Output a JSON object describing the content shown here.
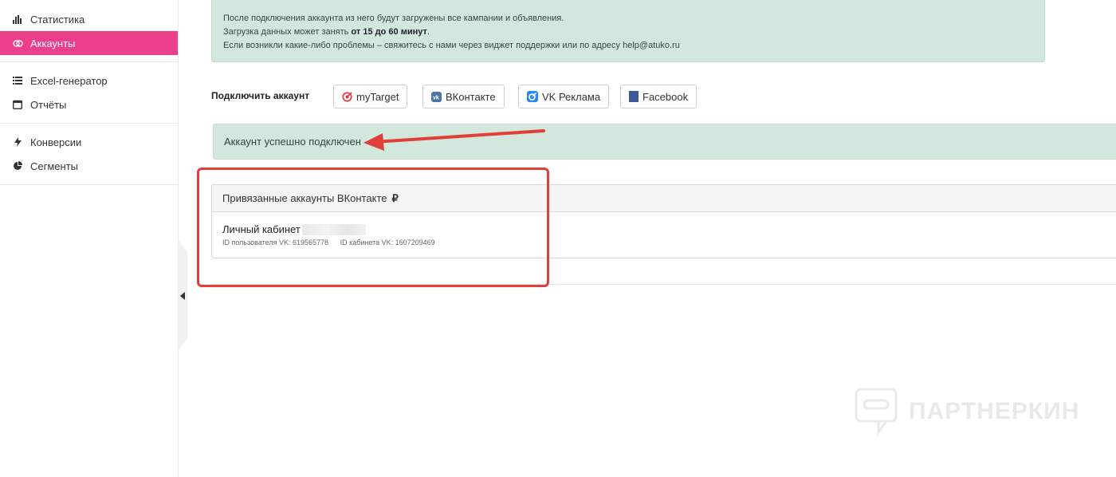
{
  "sidebar": {
    "groups": [
      [
        {
          "label": "Статистика",
          "icon": "bar-chart-icon"
        },
        {
          "label": "Аккаунты",
          "icon": "link-icon",
          "active": true
        }
      ],
      [
        {
          "label": "Excel-генератор",
          "icon": "list-icon"
        },
        {
          "label": "Отчёты",
          "icon": "calendar-icon"
        }
      ],
      [
        {
          "label": "Конверсии",
          "icon": "bolt-icon"
        },
        {
          "label": "Сегменты",
          "icon": "pie-chart-icon"
        }
      ]
    ]
  },
  "info": {
    "line1": "После подключения аккаунта из него будут загружены все кампании и объявления.",
    "line2_prefix": "Загрузка данных может занять ",
    "line2_bold": "от 15 до 60 минут",
    "line2_suffix": ".",
    "line3": "Если возникли какие-либо проблемы – свяжитесь с нами через виджет поддержки или по адресу help@atuko.ru"
  },
  "connect": {
    "label": "Подключить аккаунт",
    "buttons": [
      {
        "label": "myTarget",
        "icon": "mytarget-icon"
      },
      {
        "label": "ВКонтакте",
        "icon": "vk-icon"
      },
      {
        "label": "VK Реклама",
        "icon": "vk-ads-icon"
      },
      {
        "label": "Facebook",
        "icon": "facebook-icon"
      }
    ]
  },
  "success_message": "Аккаунт успешно подключен",
  "linked": {
    "title": "Привязанные аккаунты ВКонтакте",
    "currency": "₽",
    "account": {
      "name": "Личный кабинет",
      "user_id": "ID пользователя VK: 619565778",
      "cabinet_id": "ID кабинета VK: 1607209469"
    }
  },
  "watermark": "ПАРТНЕРКИН",
  "colors": {
    "accent": "#ec3e8a",
    "alert_bg": "#d3e8dd",
    "annotation": "#e03f3a"
  }
}
